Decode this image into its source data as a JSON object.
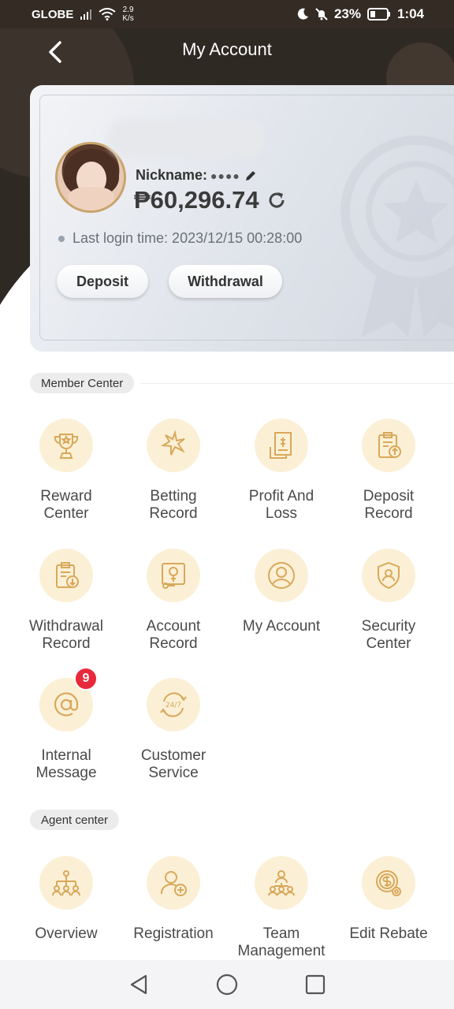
{
  "status_bar": {
    "carrier": "GLOBE",
    "speed_value": "2.9",
    "speed_unit": "K/s",
    "battery": "23%",
    "time": "1:04"
  },
  "header": {
    "title": "My Account"
  },
  "account_card": {
    "nickname_label": "Nickname:",
    "nickname_masked": "●●●●",
    "balance": "₱60,296.74",
    "last_login": "Last login time: 2023/12/15 00:28:00",
    "deposit_label": "Deposit",
    "withdrawal_label": "Withdrawal"
  },
  "member_center": {
    "title": "Member Center",
    "items": [
      {
        "label1": "Reward",
        "label2": "Center",
        "icon": "trophy-icon"
      },
      {
        "label1": "Betting",
        "label2": "Record",
        "icon": "betting-icon"
      },
      {
        "label1": "Profit And",
        "label2": "Loss",
        "icon": "invoice-icon"
      },
      {
        "label1": "Deposit",
        "label2": "Record",
        "icon": "clipboard-upload-icon"
      },
      {
        "label1": "Withdrawal",
        "label2": "Record",
        "icon": "clipboard-download-icon"
      },
      {
        "label1": "Account",
        "label2": "Record",
        "icon": "account-record-icon"
      },
      {
        "label1": "My Account",
        "label2": "",
        "icon": "user-icon"
      },
      {
        "label1": "Security",
        "label2": "Center",
        "icon": "shield-icon"
      },
      {
        "label1": "Internal",
        "label2": "Message",
        "icon": "at-icon",
        "badge": "9"
      },
      {
        "label1": "Customer",
        "label2": "Service",
        "icon": "support-24-7-icon"
      }
    ]
  },
  "agent_center": {
    "title": "Agent center",
    "items": [
      {
        "label1": "Overview",
        "label2": "",
        "icon": "org-chart-icon"
      },
      {
        "label1": "Registration",
        "label2": "",
        "icon": "add-user-icon"
      },
      {
        "label1": "Team",
        "label2": "Management",
        "icon": "team-icon"
      },
      {
        "label1": "Edit Rebate",
        "label2": "",
        "icon": "rebate-coin-icon"
      }
    ]
  },
  "colors": {
    "header_bg": "#2f2924",
    "icon_bg": "#fbf0d6",
    "icon_stroke": "#d9a85a",
    "badge": "#e8293b"
  }
}
